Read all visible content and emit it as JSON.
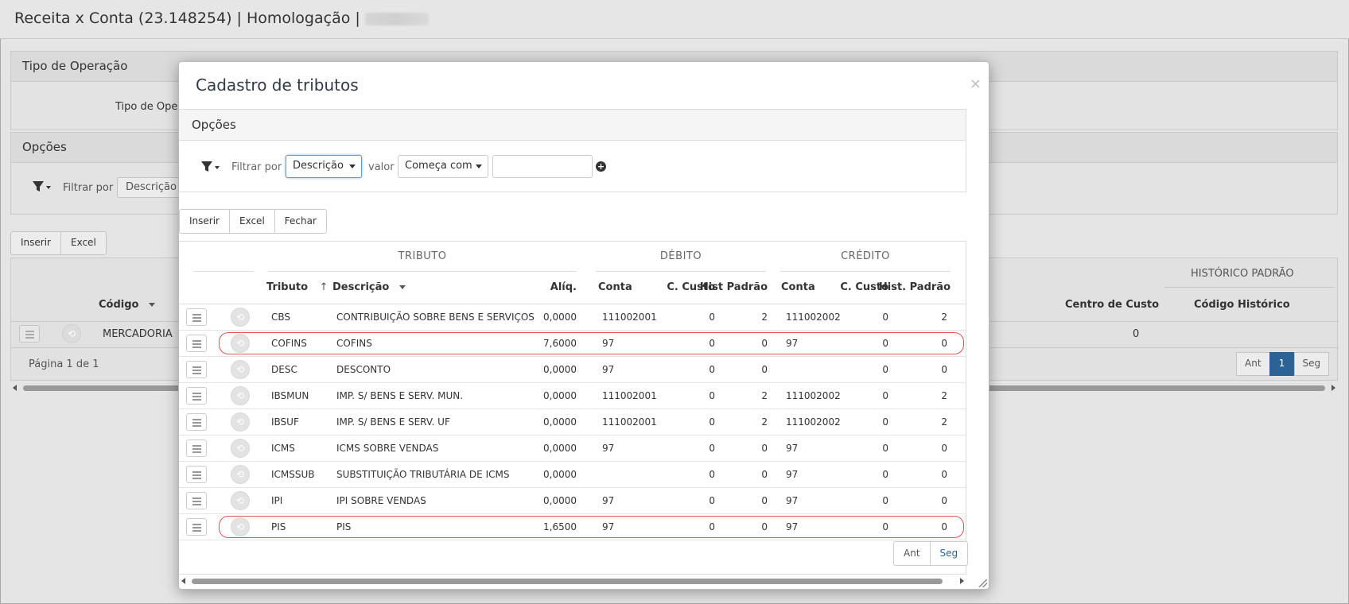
{
  "app": {
    "title": "Receita x Conta (23.148254) | Homologação |"
  },
  "background": {
    "tipo_operacao_panel": {
      "title": "Tipo de Operação",
      "field_label": "Tipo de Oper"
    },
    "opcoes_panel": {
      "title": "Opções",
      "filter_label": "Filtrar por",
      "filter_value": "Descrição d"
    },
    "toolbar": {
      "insert": "Inserir",
      "excel": "Excel"
    },
    "grid": {
      "group_historico": "HISTÓRICO PADRÃO",
      "col_codigo": "Código",
      "col_centro_custo": "Centro de Custo",
      "col_codigo_historico": "Código Histórico",
      "row": {
        "name": "MERCADORIA",
        "centro_custo": "0"
      },
      "page_info": "Página 1 de 1"
    },
    "pager": {
      "prev": "Ant",
      "current": "1",
      "next": "Seg"
    }
  },
  "modal": {
    "title": "Cadastro de tributos",
    "close": "×",
    "options": {
      "title": "Opções",
      "filter_label": "Filtrar por",
      "filter_field": "Descrição",
      "value_label": "valor",
      "operator": "Começa com",
      "value": ""
    },
    "toolbar": {
      "insert": "Inserir",
      "excel": "Excel",
      "close": "Fechar"
    },
    "grid": {
      "groups": {
        "tributo": "TRIBUTO",
        "debito": "DÉBITO",
        "credito": "CRÉDITO"
      },
      "columns": {
        "tributo": "Tributo",
        "descricao": "Descrição",
        "aliq": "Alíq.",
        "deb_conta": "Conta",
        "deb_custo": "C. Custo",
        "deb_hist": "Hist Padrão",
        "cred_conta": "Conta",
        "cred_custo": "C. Custo",
        "cred_hist": "Hist. Padrão"
      },
      "rows": [
        {
          "tributo": "CBS",
          "descricao": "CONTRIBUIÇÃO SOBRE BENS E SERVIÇOS",
          "aliq": "0,0000",
          "deb_conta": "111002001",
          "deb_custo": "0",
          "deb_hist": "2",
          "cred_conta": "111002002",
          "cred_custo": "0",
          "cred_hist": "2"
        },
        {
          "tributo": "COFINS",
          "descricao": "COFINS",
          "aliq": "7,6000",
          "deb_conta": "97",
          "deb_custo": "0",
          "deb_hist": "0",
          "cred_conta": "97",
          "cred_custo": "0",
          "cred_hist": "0"
        },
        {
          "tributo": "DESC",
          "descricao": "DESCONTO",
          "aliq": "0,0000",
          "deb_conta": "97",
          "deb_custo": "0",
          "deb_hist": "0",
          "cred_conta": "",
          "cred_custo": "0",
          "cred_hist": "0"
        },
        {
          "tributo": "IBSMUN",
          "descricao": "IMP. S/ BENS E SERV. MUN.",
          "aliq": "0,0000",
          "deb_conta": "111002001",
          "deb_custo": "0",
          "deb_hist": "2",
          "cred_conta": "111002002",
          "cred_custo": "0",
          "cred_hist": "2"
        },
        {
          "tributo": "IBSUF",
          "descricao": "IMP. S/ BENS E SERV. UF",
          "aliq": "0,0000",
          "deb_conta": "111002001",
          "deb_custo": "0",
          "deb_hist": "2",
          "cred_conta": "111002002",
          "cred_custo": "0",
          "cred_hist": "2"
        },
        {
          "tributo": "ICMS",
          "descricao": "ICMS SOBRE VENDAS",
          "aliq": "0,0000",
          "deb_conta": "97",
          "deb_custo": "0",
          "deb_hist": "0",
          "cred_conta": "97",
          "cred_custo": "0",
          "cred_hist": "0"
        },
        {
          "tributo": "ICMSSUB",
          "descricao": "SUBSTITUIÇÃO TRIBUTÁRIA DE ICMS",
          "aliq": "0,0000",
          "deb_conta": "",
          "deb_custo": "0",
          "deb_hist": "0",
          "cred_conta": "97",
          "cred_custo": "0",
          "cred_hist": "0"
        },
        {
          "tributo": "IPI",
          "descricao": "IPI SOBRE VENDAS",
          "aliq": "0,0000",
          "deb_conta": "97",
          "deb_custo": "0",
          "deb_hist": "0",
          "cred_conta": "97",
          "cred_custo": "0",
          "cred_hist": "0"
        },
        {
          "tributo": "PIS",
          "descricao": "PIS",
          "aliq": "1,6500",
          "deb_conta": "97",
          "deb_custo": "0",
          "deb_hist": "0",
          "cred_conta": "97",
          "cred_custo": "0",
          "cred_hist": "0"
        }
      ],
      "highlighted_tributos": [
        "COFINS",
        "PIS"
      ],
      "highlight_color": "#e05454"
    },
    "pager": {
      "prev": "Ant",
      "next": "Seg"
    }
  }
}
